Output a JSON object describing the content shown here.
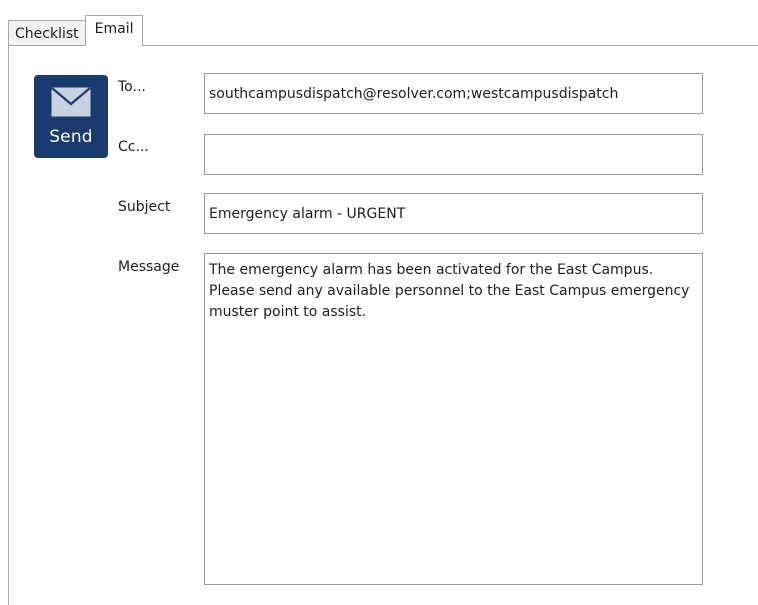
{
  "tabs": [
    {
      "label": "Checklist",
      "active": false
    },
    {
      "label": "Email",
      "active": true
    }
  ],
  "send_button": {
    "label": "Send",
    "icon": "envelope-icon",
    "color": "#1b3b6f"
  },
  "fields": {
    "to": {
      "label": "To...",
      "value": "southcampusdispatch@resolver.com;westcampusdispatch"
    },
    "cc": {
      "label": "Cc...",
      "value": ""
    },
    "subject": {
      "label": "Subject",
      "value": "Emergency alarm - URGENT"
    },
    "message": {
      "label": "Message",
      "value": "The emergency alarm has been activated for the East Campus. Please send any available personnel to the East Campus emergency muster point to assist."
    }
  }
}
